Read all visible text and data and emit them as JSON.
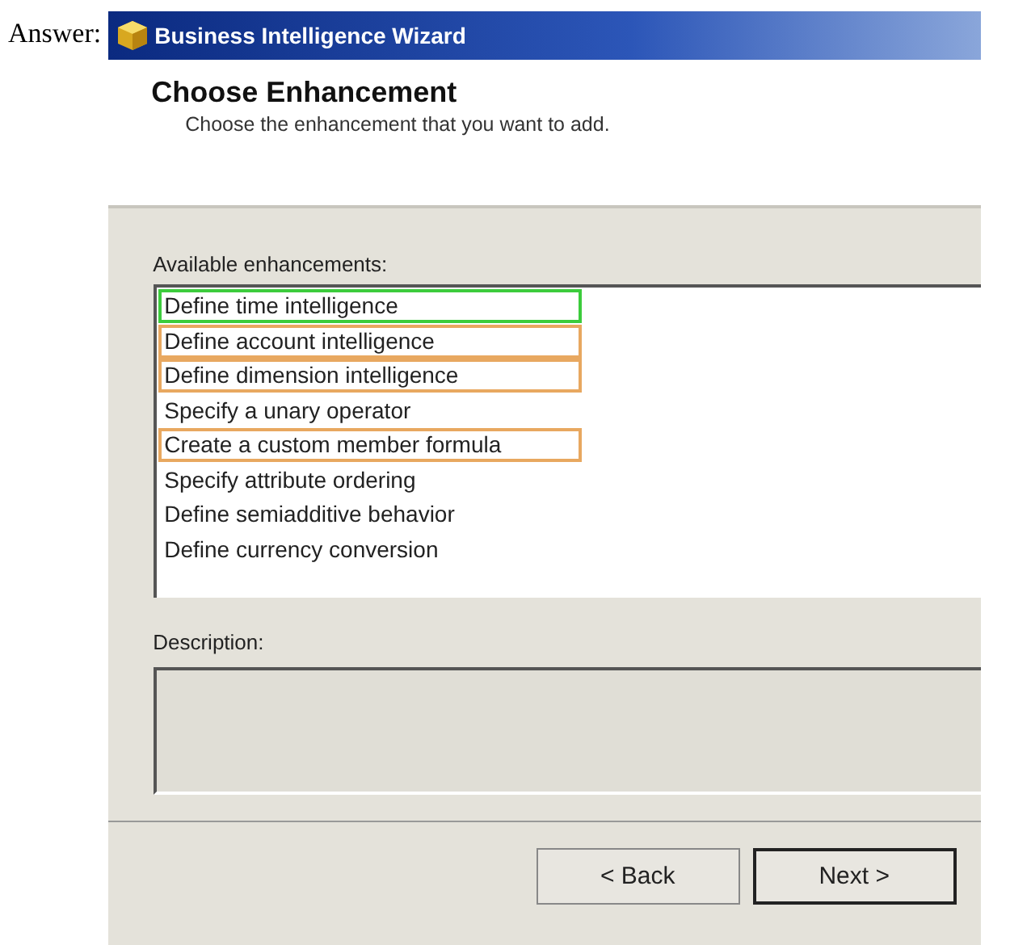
{
  "label": "Answer:",
  "window": {
    "title": "Business Intelligence Wizard"
  },
  "header": {
    "title": "Choose Enhancement",
    "subtitle": "Choose the enhancement that you want to add."
  },
  "enhancements": {
    "label": "Available enhancements:",
    "items": [
      {
        "text": "Define time intelligence",
        "color": "#3ccc3c"
      },
      {
        "text": "Define account intelligence",
        "color": "#e8a860"
      },
      {
        "text": "Define dimension intelligence",
        "color": "#e8a860"
      },
      {
        "text": "Specify a unary operator"
      },
      {
        "text": "Create a custom member formula",
        "color": "#e8a860"
      },
      {
        "text": "Specify attribute ordering"
      },
      {
        "text": "Define semiadditive behavior"
      },
      {
        "text": "Define currency conversion"
      }
    ]
  },
  "description": {
    "label": "Description:"
  },
  "buttons": [
    "< Back",
    "Next >"
  ]
}
